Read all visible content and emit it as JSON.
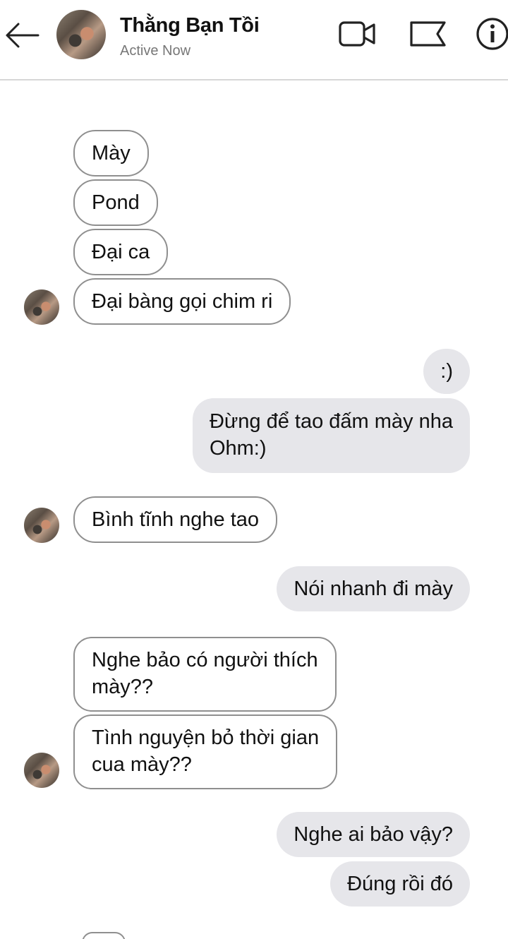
{
  "header": {
    "contact_name": "Thằng Bạn Tồi",
    "status": "Active Now",
    "icons": [
      "back-arrow-icon",
      "video-call-icon",
      "flag-icon",
      "info-icon"
    ]
  },
  "messages": [
    {
      "from": "contact",
      "text": "Mày"
    },
    {
      "from": "contact",
      "text": "Pond"
    },
    {
      "from": "contact",
      "text": "Đại ca"
    },
    {
      "from": "contact",
      "text": "Đại bàng gọi chim ri"
    },
    {
      "from": "me",
      "text": ":)"
    },
    {
      "from": "me",
      "lines": [
        "Đừng để tao đấm mày nha",
        "Ohm:)"
      ]
    },
    {
      "from": "contact",
      "text": "Bình tĩnh nghe tao"
    },
    {
      "from": "me",
      "text": "Nói nhanh đi mày"
    },
    {
      "from": "contact",
      "lines": [
        "Nghe bảo có người thích",
        "mày??"
      ]
    },
    {
      "from": "contact",
      "lines": [
        "Tình nguyện bỏ thời gian",
        "cua mày??"
      ]
    },
    {
      "from": "me",
      "text": "Nghe ai bảo vậy?"
    },
    {
      "from": "me",
      "text": "Đúng rồi đó"
    }
  ],
  "colors": {
    "outgoing_bubble": "#e6e6ea",
    "incoming_border": "#8f8f8f",
    "subtitle": "#777777"
  }
}
